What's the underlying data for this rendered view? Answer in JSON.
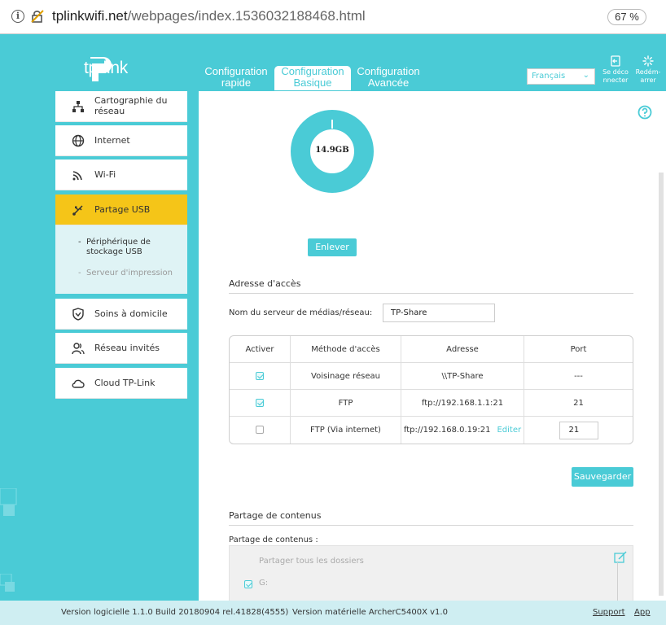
{
  "browser": {
    "url_host": "tplinkwifi.net",
    "url_path": "/webpages/index.1536032188468.html",
    "zoom": "67 %"
  },
  "header": {
    "brand": "tp-link",
    "tabs": [
      {
        "line1": "Configuration",
        "line2": "rapide"
      },
      {
        "line1": "Configuration",
        "line2": "Basique"
      },
      {
        "line1": "Configuration",
        "line2": "Avancée"
      }
    ],
    "active_tab": 1,
    "language": "Français",
    "logout": {
      "line1": "Se déco",
      "line2": "nnecter"
    },
    "reboot": {
      "line1": "Redém-",
      "line2": "arrer"
    }
  },
  "sidebar": {
    "items": [
      {
        "label_line1": "Cartographie du",
        "label_line2": "réseau",
        "icon": "network-map-icon"
      },
      {
        "label": "Internet",
        "icon": "globe-icon"
      },
      {
        "label": "Wi-Fi",
        "icon": "wifi-icon"
      },
      {
        "label": "Partage USB",
        "icon": "usb-icon",
        "active": true
      },
      {
        "label": "Soins à domicile",
        "icon": "shield-icon"
      },
      {
        "label": "Réseau invités",
        "icon": "guests-icon"
      },
      {
        "label": "Cloud TP-Link",
        "icon": "cloud-icon"
      }
    ],
    "submenu": [
      {
        "line1": "Périphérique de",
        "line2": "stockage USB",
        "active": true
      },
      {
        "line1": "Serveur d'impression",
        "active": false
      }
    ]
  },
  "storage": {
    "capacity": "14.9GB",
    "remove_label": "Enlever"
  },
  "access": {
    "section_title": "Adresse d'accès",
    "server_name_label": "Nom du serveur de médias/réseau:",
    "server_name_value": "TP-Share",
    "table": {
      "headers": [
        "Activer",
        "Méthode d'accès",
        "Adresse",
        "Port"
      ],
      "rows": [
        {
          "enabled": true,
          "method": "Voisinage réseau",
          "address": "\\\\TP-Share",
          "port": "---"
        },
        {
          "enabled": true,
          "method": "FTP",
          "address": "ftp://192.168.1.1:21",
          "port": "21"
        },
        {
          "enabled": false,
          "method": "FTP (Via internet)",
          "address": "ftp://192.168.0.19:21",
          "edit": "Editer",
          "port": "21"
        }
      ]
    },
    "save_label": "Sauvegarder"
  },
  "sharing": {
    "section_title": "Partage de contenus",
    "label": "Partage de contenus :",
    "share_all": "Partager tous les dossiers",
    "folder": "G:"
  },
  "footer": {
    "software": "Version logicielle 1.1.0 Build 20180904 rel.41828(4555)",
    "hardware": "Version matérielle ArcherC5400X v1.0",
    "support": "Support",
    "app": "App"
  },
  "colors": {
    "brand": "#4acbd6",
    "active_menu": "#f5c518",
    "submenu_bg": "#dff3f5"
  }
}
